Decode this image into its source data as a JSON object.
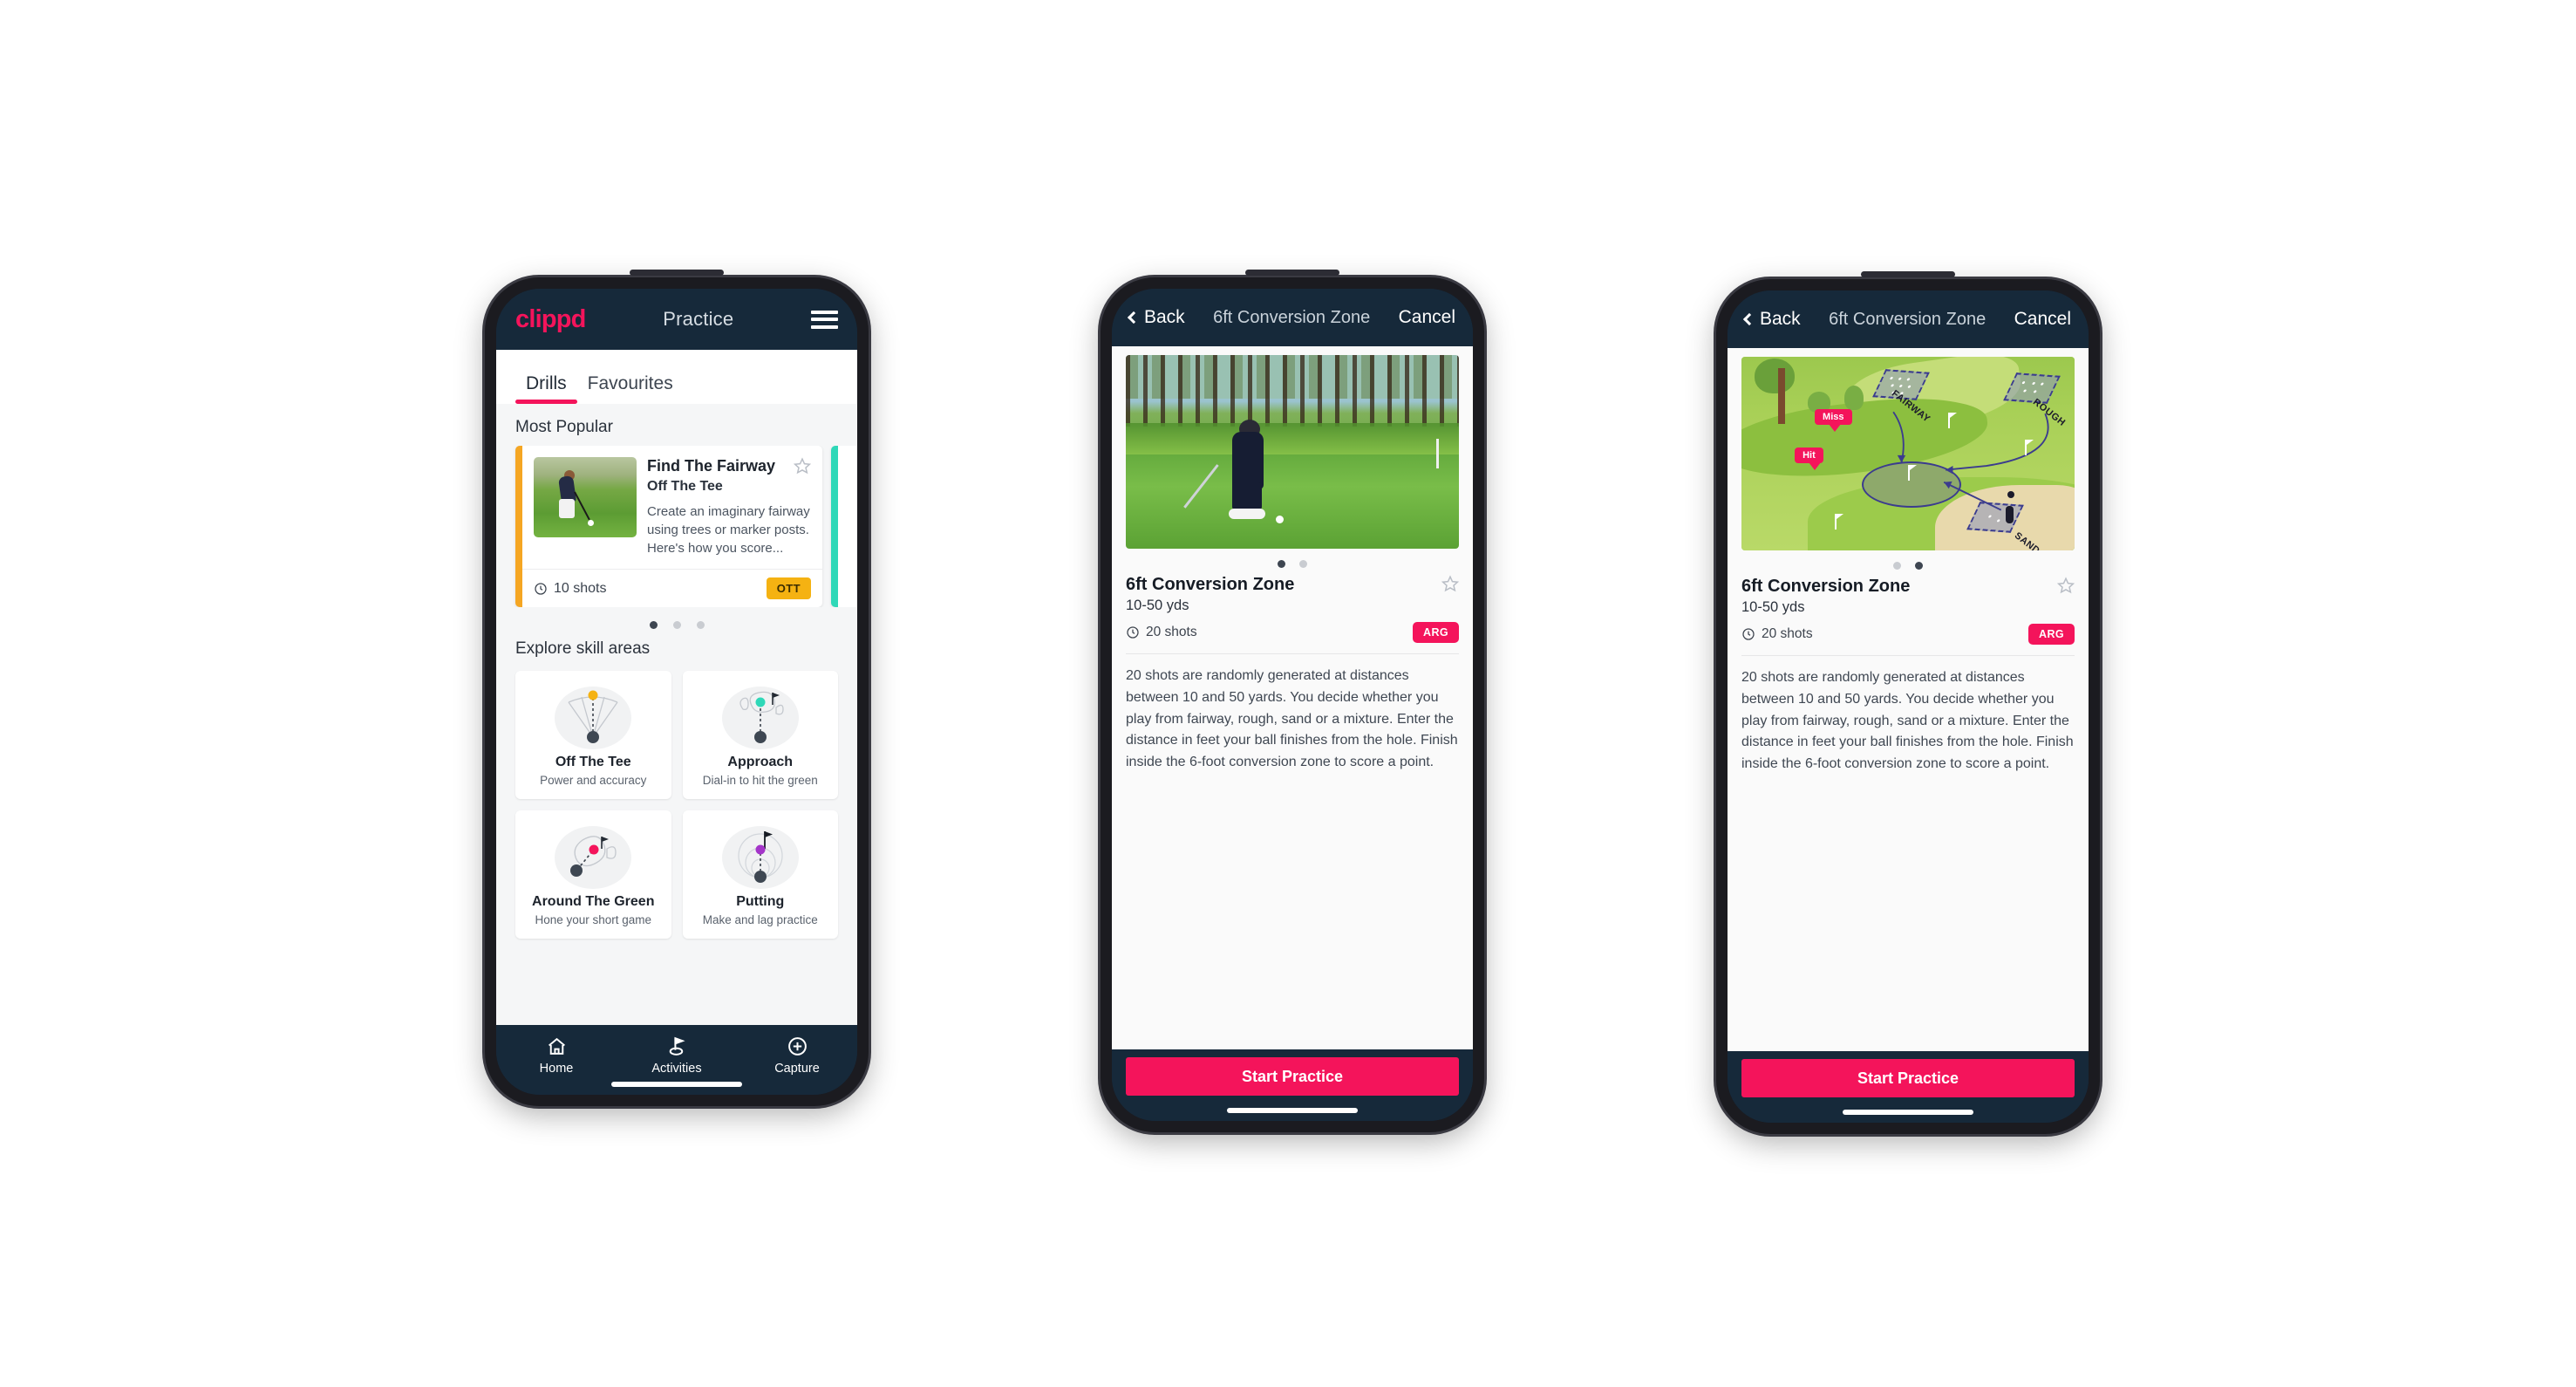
{
  "phone1": {
    "topbar": {
      "logo": "clippd",
      "title": "Practice",
      "menu_icon": "hamburger-icon"
    },
    "tabs": [
      {
        "label": "Drills",
        "active": true
      },
      {
        "label": "Favourites",
        "active": false
      }
    ],
    "sections": {
      "most_popular": "Most Popular",
      "explore": "Explore skill areas"
    },
    "drill_card": {
      "title": "Find The Fairway",
      "subtitle": "Off The Tee",
      "description": "Create an imaginary fairway using trees or marker posts. Here's how you score...",
      "shots": "10 shots",
      "badge": "OTT",
      "badge_color": "#f5b212",
      "accent_color": "#f5a623",
      "next_accent_color": "#2fd8b8",
      "star_icon": "star-outline-icon",
      "clock_icon": "clock-icon"
    },
    "carousel_dots": {
      "count": 3,
      "active": 0
    },
    "skill_areas": [
      {
        "name": "Off The Tee",
        "desc": "Power and accuracy",
        "icon": "tee-fan-icon",
        "dot_color": "#f5b212"
      },
      {
        "name": "Approach",
        "desc": "Dial-in to hit the green",
        "icon": "green-approach-icon",
        "dot_color": "#2fd8b8"
      },
      {
        "name": "Around The Green",
        "desc": "Hone your short game",
        "icon": "chip-icon",
        "dot_color": "#f4145b"
      },
      {
        "name": "Putting",
        "desc": "Make and lag practice",
        "icon": "putting-rings-icon",
        "dot_color": "#a435c9"
      }
    ],
    "nav": [
      {
        "label": "Home",
        "icon": "home-icon",
        "active": false
      },
      {
        "label": "Activities",
        "icon": "golf-flag-icon",
        "active": true
      },
      {
        "label": "Capture",
        "icon": "plus-circle-icon",
        "active": false
      }
    ]
  },
  "phone2": {
    "topbar": {
      "back": "Back",
      "title": "6ft Conversion Zone",
      "cancel": "Cancel"
    },
    "hero": "photo-golfer-chipping",
    "dots": {
      "count": 2,
      "active": 0
    },
    "detail": {
      "title": "6ft Conversion Zone",
      "yards": "10-50 yds",
      "shots": "20 shots",
      "badge": "ARG",
      "badge_color": "#f4145b",
      "star_icon": "star-outline-icon",
      "clock_icon": "clock-icon",
      "description": "20 shots are randomly generated at distances between 10 and 50 yards. You decide whether you play from fairway, rough, sand or a mixture. Enter the distance in feet your ball finishes from the hole. Finish inside the 6-foot conversion zone to score a point."
    },
    "cta": "Start Practice"
  },
  "phone3": {
    "topbar": {
      "back": "Back",
      "title": "6ft Conversion Zone",
      "cancel": "Cancel"
    },
    "hero": "illustration-course-map",
    "illustration": {
      "labels": [
        "FAIRWAY",
        "ROUGH",
        "SAND"
      ],
      "tags": [
        "Miss",
        "Hit"
      ],
      "tag_color": "#f4145b"
    },
    "dots": {
      "count": 2,
      "active": 1
    },
    "detail": {
      "title": "6ft Conversion Zone",
      "yards": "10-50 yds",
      "shots": "20 shots",
      "badge": "ARG",
      "badge_color": "#f4145b",
      "star_icon": "star-outline-icon",
      "clock_icon": "clock-icon",
      "description": "20 shots are randomly generated at distances between 10 and 50 yards. You decide whether you play from fairway, rough, sand or a mixture. Enter the distance in feet your ball finishes from the hole. Finish inside the 6-foot conversion zone to score a point."
    },
    "cta": "Start Practice"
  }
}
